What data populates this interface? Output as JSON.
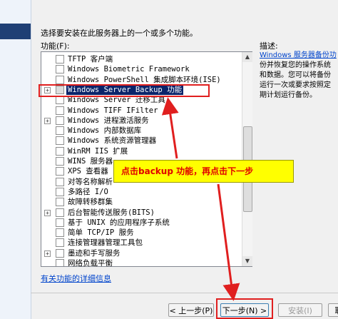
{
  "intro_text": "选择要安装在此服务器上的一个或多个功能。",
  "features_label": "功能(F):",
  "description_label": "描述:",
  "description_link": "Windows 服务器备份功",
  "description_text": "份并恢复您的操作系统\n和数据。您可以将备份\n运行一次或要求按照定\n期计划运行备份。",
  "features": [
    {
      "label": "TFTP 客户端",
      "expander": false,
      "selected": false
    },
    {
      "label": "Windows Biometric Framework",
      "expander": false,
      "selected": false
    },
    {
      "label": "Windows PowerShell 集成脚本环境(ISE)",
      "expander": false,
      "selected": false
    },
    {
      "label": "Windows Server Backup 功能",
      "expander": true,
      "expander_symbol": "+",
      "selected": true
    },
    {
      "label": "Windows Server 迁移工具",
      "expander": false,
      "selected": false
    },
    {
      "label": "Windows TIFF IFilter",
      "expander": false,
      "selected": false
    },
    {
      "label": "Windows 进程激活服务",
      "expander": true,
      "expander_symbol": "+",
      "selected": false
    },
    {
      "label": "Windows 内部数据库",
      "expander": false,
      "selected": false
    },
    {
      "label": "Windows 系统资源管理器",
      "expander": false,
      "selected": false
    },
    {
      "label": "WinRM IIS 扩展",
      "expander": false,
      "selected": false
    },
    {
      "label": "WINS 服务器",
      "expander": false,
      "selected": false
    },
    {
      "label": "XPS 查看器",
      "expander": false,
      "selected": false
    },
    {
      "label": "对等名称解析",
      "expander": false,
      "selected": false
    },
    {
      "label": "多路径 I/O",
      "expander": false,
      "selected": false
    },
    {
      "label": "故障转移群集",
      "expander": false,
      "selected": false
    },
    {
      "label": "后台智能传送服务(BITS)",
      "expander": true,
      "expander_symbol": "+",
      "selected": false
    },
    {
      "label": "基于 UNIX 的应用程序子系统",
      "expander": false,
      "selected": false
    },
    {
      "label": "简单 TCP/IP 服务",
      "expander": false,
      "selected": false
    },
    {
      "label": "连接管理器管理工具包",
      "expander": false,
      "selected": false
    },
    {
      "label": "墨迹和手写服务",
      "expander": true,
      "expander_symbol": "+",
      "selected": false
    },
    {
      "label": "网络负载平衡",
      "expander": false,
      "selected": false
    }
  ],
  "details_link": "有关功能的详细信息",
  "buttons": {
    "prev": "< 上一步(P)",
    "next": "下一步(N) >",
    "install": "安装(I)",
    "cancel": "取"
  },
  "callout_text": "点击backup 功能，再点击下一步",
  "colors": {
    "callout_bg": "#ffff00",
    "callout_text": "#e00000",
    "highlight": "#e01f1f",
    "selection": "#0a246a"
  }
}
